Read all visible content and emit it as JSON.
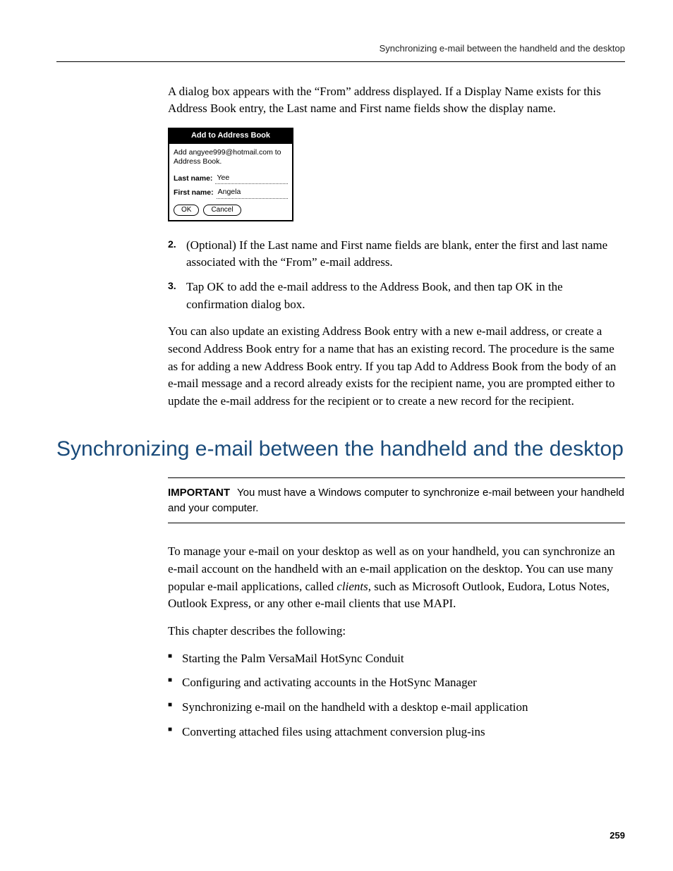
{
  "header": {
    "running": "Synchronizing e-mail between the handheld and the desktop"
  },
  "intro": {
    "para1": "A dialog box appears with the “From” address displayed. If a Display Name exists for this Address Book entry, the Last name and First name fields show the display name."
  },
  "dialog": {
    "title": "Add to Address Book",
    "message": "Add angyee999@hotmail.com to Address Book.",
    "last_label": "Last name:",
    "last_value": "Yee",
    "first_label": "First name:",
    "first_value": "Angela",
    "ok": "OK",
    "cancel": "Cancel"
  },
  "steps": {
    "s2_num": "2.",
    "s2": "(Optional) If the Last name and First name fields are blank, enter the first and last name associated with the “From” e-mail address.",
    "s3_num": "3.",
    "s3": "Tap OK to add the e-mail address to the Address Book, and then tap OK in the confirmation dialog box."
  },
  "follow": {
    "para": "You can also update an existing Address Book entry with a new e-mail address, or create a second Address Book entry for a name that has an existing record. The procedure is the same as for adding a new Address Book entry. If you tap Add to Address Book from the body of an e-mail message and a record already exists for the recipient name, you are prompted either to update the e-mail address for the recipient or to create a new record for the recipient."
  },
  "section": {
    "title": "Synchronizing e-mail between the handheld and the desktop"
  },
  "important": {
    "label": "IMPORTANT",
    "text": "You must have a Windows computer to synchronize e-mail between your handheld and your computer."
  },
  "body2": {
    "p1a": "To manage your e-mail on your desktop as well as on your handheld, you can synchronize an e-mail account on the handheld with an e-mail application on the desktop. You can use many popular e-mail applications, called ",
    "p1_em": "clients",
    "p1b": ", such as Microsoft Outlook, Eudora, Lotus Notes, Outlook Express, or any other e-mail clients that use MAPI.",
    "p2": "This chapter describes the following:"
  },
  "bullets": {
    "b1": "Starting the Palm VersaMail HotSync Conduit",
    "b2": "Configuring and activating accounts in the HotSync Manager",
    "b3": "Synchronizing e-mail on the handheld with a desktop e-mail application",
    "b4": "Converting attached files using attachment conversion plug-ins"
  },
  "page_number": "259"
}
